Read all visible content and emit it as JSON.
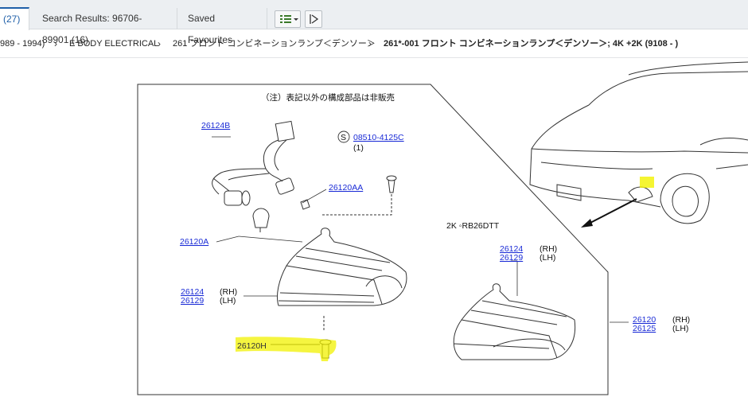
{
  "tabs": [
    {
      "label": "(27)"
    },
    {
      "label": "Search Results: 96706-89901 (16)"
    },
    {
      "label": "Saved Favourites"
    }
  ],
  "breadcrumb": [
    {
      "label": "989 - 1994)"
    },
    {
      "label": "E BODY ELECTRICAL"
    },
    {
      "label": "261 フロント コンビネーションランプ＜デンソー＞"
    },
    {
      "label": "261*-001 フロント コンビネーションランプ＜デンソー＞; 4K +2K (9108 - )"
    }
  ],
  "diagram": {
    "note": "（注）表記以外の構成部品は非販売",
    "variant_label": "2K ◦RB26DTT",
    "screw_qty": "(1)",
    "screw_prefix": "S",
    "parts": {
      "p26124B": "26124B",
      "p08510": "08510-4125C",
      "p26120AA": "26120AA",
      "p26120A": "26120A",
      "p26124": "26124",
      "p26129": "26129",
      "p26120H": "26120H",
      "p26124b2": "26124",
      "p26129b2": "26129",
      "p26120": "26120",
      "p26125": "26125"
    },
    "rh": "(RH)",
    "lh": "(LH)"
  },
  "colors": {
    "link": "#1a2bd6",
    "highlight": "#f2f200",
    "accent": "#1f5fa8"
  }
}
